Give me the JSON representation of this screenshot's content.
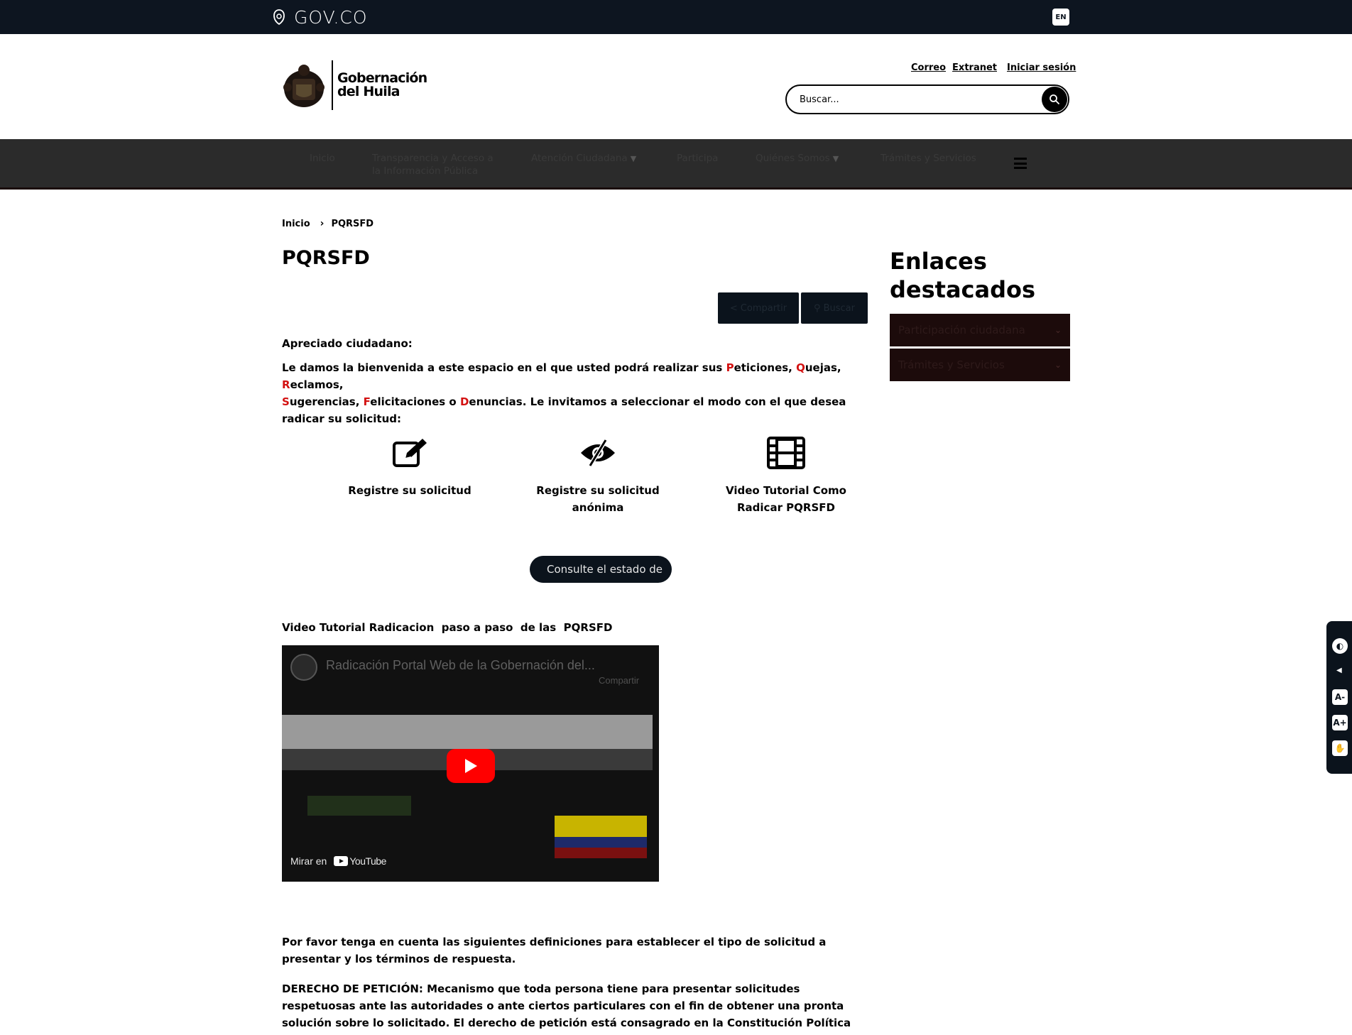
{
  "govbar": {
    "brand": "GOV.CO",
    "lang": "EN"
  },
  "header": {
    "brand_line1": "Gobernación",
    "brand_line2": "del Huila",
    "links": {
      "correo": "Correo",
      "extranet": "Extranet",
      "login": "Iniciar sesión"
    },
    "search_placeholder": "Buscar..."
  },
  "nav": {
    "items": [
      {
        "label": "Inicio"
      },
      {
        "label": "Transparencia y Acceso a",
        "label2": "la Información Pública"
      },
      {
        "label": "Atención Ciudadana"
      },
      {
        "label": "Participa"
      },
      {
        "label": "Quiénes Somos"
      },
      {
        "label": "Trámites y Servicios"
      }
    ]
  },
  "breadcrumb": {
    "home": "Inicio",
    "current": "PQRSFD"
  },
  "page": {
    "title": "PQRSFD",
    "share_label": "Compartir",
    "find_label": "Buscar",
    "greeting": "Apreciado ciudadano:",
    "welcome": {
      "t1": "Le damos la bienvenida a este espacio en el que usted podrá realizar sus ",
      "r1": "P",
      "t2": "eticiones, ",
      "r2": "Q",
      "t3": "uejas, ",
      "r3": "R",
      "t4": "eclamos,",
      "r4": "S",
      "t5": "ugerencias, ",
      "r5": "F",
      "t6": "elicitaciones o ",
      "r6": "D",
      "t7": "enuncias. Le invitamos a seleccionar el modo con el que desea radicar su solicitud:"
    },
    "options": [
      {
        "line1": "Registre su solicitud",
        "line2": ""
      },
      {
        "line1": "Registre su solicitud",
        "line2": "anónima"
      },
      {
        "line1": "Video Tutorial Como",
        "line2": "Radicar PQRSFD"
      }
    ],
    "consult_button": "Consulte el estado de",
    "video_heading": "Video Tutorial Radicacion  paso a paso  de las  PQRSFD",
    "video": {
      "title": "Radicación Portal Web de la Gobernación del...",
      "share": "Compartir",
      "watch_on": "Mirar en",
      "youtube": "YouTube"
    },
    "para1": "Por favor tenga en cuenta las siguientes definiciones para establecer el tipo de solicitud a presentar y los términos de respuesta.",
    "para2": "DERECHO DE PETICIÓN: Mecanismo que toda persona tiene para presentar solicitudes respetuosas ante las autoridades o ante ciertos particulares con el fin de obtener una pronta solución sobre lo solicitado. El derecho de petición está consagrado en la Constitución Política de Colombia como fundamental, es decir, que hace parte de los derechos de las personas y que su protección judicial inmediata puede"
  },
  "sidebar": {
    "title_line1": "Enlaces",
    "title_line2": "destacados",
    "accordion": [
      "Participación ciudadana",
      "Trámites y Servicios"
    ]
  },
  "colors": {
    "govbar": "#0d1520",
    "nav": "#2b2b2b",
    "accent_red": "#d31111",
    "dark_button": "#0b131c"
  }
}
